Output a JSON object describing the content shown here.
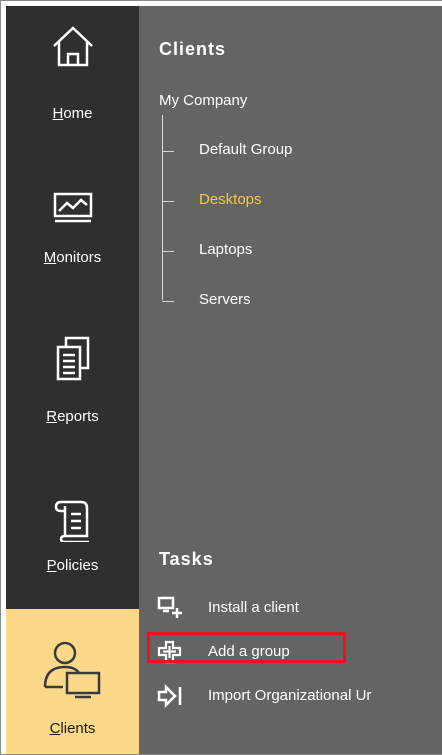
{
  "nav": {
    "home": {
      "label_u": "H",
      "label_rest": "ome"
    },
    "monitors": {
      "label_u": "M",
      "label_rest": "onitors"
    },
    "reports": {
      "label_u": "R",
      "label_rest": "eports"
    },
    "policies": {
      "label_u": "P",
      "label_rest": "olicies"
    },
    "clients": {
      "label_u": "C",
      "label_rest": "lients",
      "active": true
    }
  },
  "clients_section": {
    "title": "Clients",
    "root": "My Company",
    "groups": [
      {
        "label": "Default Group",
        "selected": false
      },
      {
        "label": "Desktops",
        "selected": true
      },
      {
        "label": "Laptops",
        "selected": false
      },
      {
        "label": "Servers",
        "selected": false
      }
    ]
  },
  "tasks_section": {
    "title": "Tasks",
    "items": [
      {
        "label": "Install a client",
        "icon": "install-client-icon"
      },
      {
        "label": "Add a group",
        "icon": "add-group-icon",
        "highlighted": true
      },
      {
        "label": "Import Organizational Ur",
        "icon": "import-icon"
      }
    ]
  },
  "colors": {
    "nav_bg": "#2f2f2f",
    "main_bg": "#646464",
    "active_nav_bg": "#fcd98a",
    "selected_text": "#f5c842",
    "highlight_border": "#e8141c"
  }
}
